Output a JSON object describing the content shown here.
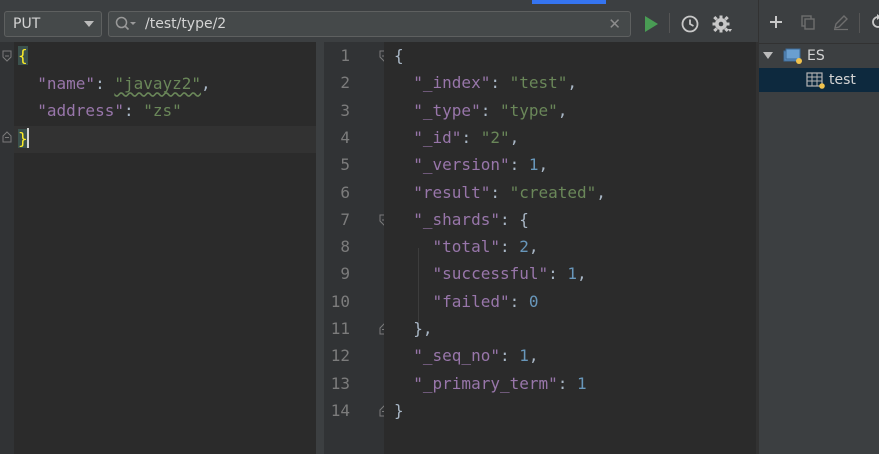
{
  "toolbar": {
    "method": "PUT",
    "url": "/test/type/2"
  },
  "request_body": [
    [
      {
        "t": "p",
        "v": "{",
        "hl": true
      }
    ],
    [
      {
        "t": "p",
        "v": "  "
      },
      {
        "t": "k",
        "v": "\"name\""
      },
      {
        "t": "p",
        "v": ": "
      },
      {
        "t": "s",
        "v": "\"javayz2\"",
        "squiggle": true
      },
      {
        "t": "p",
        "v": ","
      }
    ],
    [
      {
        "t": "p",
        "v": "  "
      },
      {
        "t": "k",
        "v": "\"address\""
      },
      {
        "t": "p",
        "v": ": "
      },
      {
        "t": "s",
        "v": "\"zs\""
      }
    ],
    [
      {
        "t": "p",
        "v": "}",
        "hl": true
      }
    ]
  ],
  "response": {
    "line_numbers": [
      "1",
      "2",
      "3",
      "4",
      "5",
      "6",
      "7",
      "8",
      "9",
      "10",
      "11",
      "12",
      "13",
      "14"
    ],
    "lines": [
      [
        {
          "t": "p",
          "v": "{"
        }
      ],
      [
        {
          "t": "p",
          "v": "  "
        },
        {
          "t": "k",
          "v": "\"_index\""
        },
        {
          "t": "p",
          "v": ": "
        },
        {
          "t": "s",
          "v": "\"test\""
        },
        {
          "t": "p",
          "v": ","
        }
      ],
      [
        {
          "t": "p",
          "v": "  "
        },
        {
          "t": "k",
          "v": "\"_type\""
        },
        {
          "t": "p",
          "v": ": "
        },
        {
          "t": "s",
          "v": "\"type\""
        },
        {
          "t": "p",
          "v": ","
        }
      ],
      [
        {
          "t": "p",
          "v": "  "
        },
        {
          "t": "k",
          "v": "\"_id\""
        },
        {
          "t": "p",
          "v": ": "
        },
        {
          "t": "s",
          "v": "\"2\""
        },
        {
          "t": "p",
          "v": ","
        }
      ],
      [
        {
          "t": "p",
          "v": "  "
        },
        {
          "t": "k",
          "v": "\"_version\""
        },
        {
          "t": "p",
          "v": ": "
        },
        {
          "t": "n",
          "v": "1"
        },
        {
          "t": "p",
          "v": ","
        }
      ],
      [
        {
          "t": "p",
          "v": "  "
        },
        {
          "t": "k",
          "v": "\"result\""
        },
        {
          "t": "p",
          "v": ": "
        },
        {
          "t": "s",
          "v": "\"created\""
        },
        {
          "t": "p",
          "v": ","
        }
      ],
      [
        {
          "t": "p",
          "v": "  "
        },
        {
          "t": "k",
          "v": "\"_shards\""
        },
        {
          "t": "p",
          "v": ": {"
        }
      ],
      [
        {
          "t": "p",
          "v": "    "
        },
        {
          "t": "k",
          "v": "\"total\""
        },
        {
          "t": "p",
          "v": ": "
        },
        {
          "t": "n",
          "v": "2"
        },
        {
          "t": "p",
          "v": ","
        }
      ],
      [
        {
          "t": "p",
          "v": "    "
        },
        {
          "t": "k",
          "v": "\"successful\""
        },
        {
          "t": "p",
          "v": ": "
        },
        {
          "t": "n",
          "v": "1"
        },
        {
          "t": "p",
          "v": ","
        }
      ],
      [
        {
          "t": "p",
          "v": "    "
        },
        {
          "t": "k",
          "v": "\"failed\""
        },
        {
          "t": "p",
          "v": ": "
        },
        {
          "t": "n",
          "v": "0"
        }
      ],
      [
        {
          "t": "p",
          "v": "  },"
        }
      ],
      [
        {
          "t": "p",
          "v": "  "
        },
        {
          "t": "k",
          "v": "\"_seq_no\""
        },
        {
          "t": "p",
          "v": ": "
        },
        {
          "t": "n",
          "v": "1"
        },
        {
          "t": "p",
          "v": ","
        }
      ],
      [
        {
          "t": "p",
          "v": "  "
        },
        {
          "t": "k",
          "v": "\"_primary_term\""
        },
        {
          "t": "p",
          "v": ": "
        },
        {
          "t": "n",
          "v": "1"
        }
      ],
      [
        {
          "t": "p",
          "v": "}"
        }
      ]
    ]
  },
  "tree": {
    "root_label": "ES",
    "child_label": "test"
  },
  "colors": {
    "key": "#9876aa",
    "string": "#6a8759",
    "number": "#6897bb",
    "run": "#499c54"
  },
  "icons": [
    "search-icon",
    "clear-icon",
    "run-icon",
    "history-icon",
    "settings-icon",
    "add-icon",
    "copy-icon",
    "edit-icon",
    "refresh-icon",
    "tree-expand-icon",
    "database-icon",
    "table-icon"
  ]
}
